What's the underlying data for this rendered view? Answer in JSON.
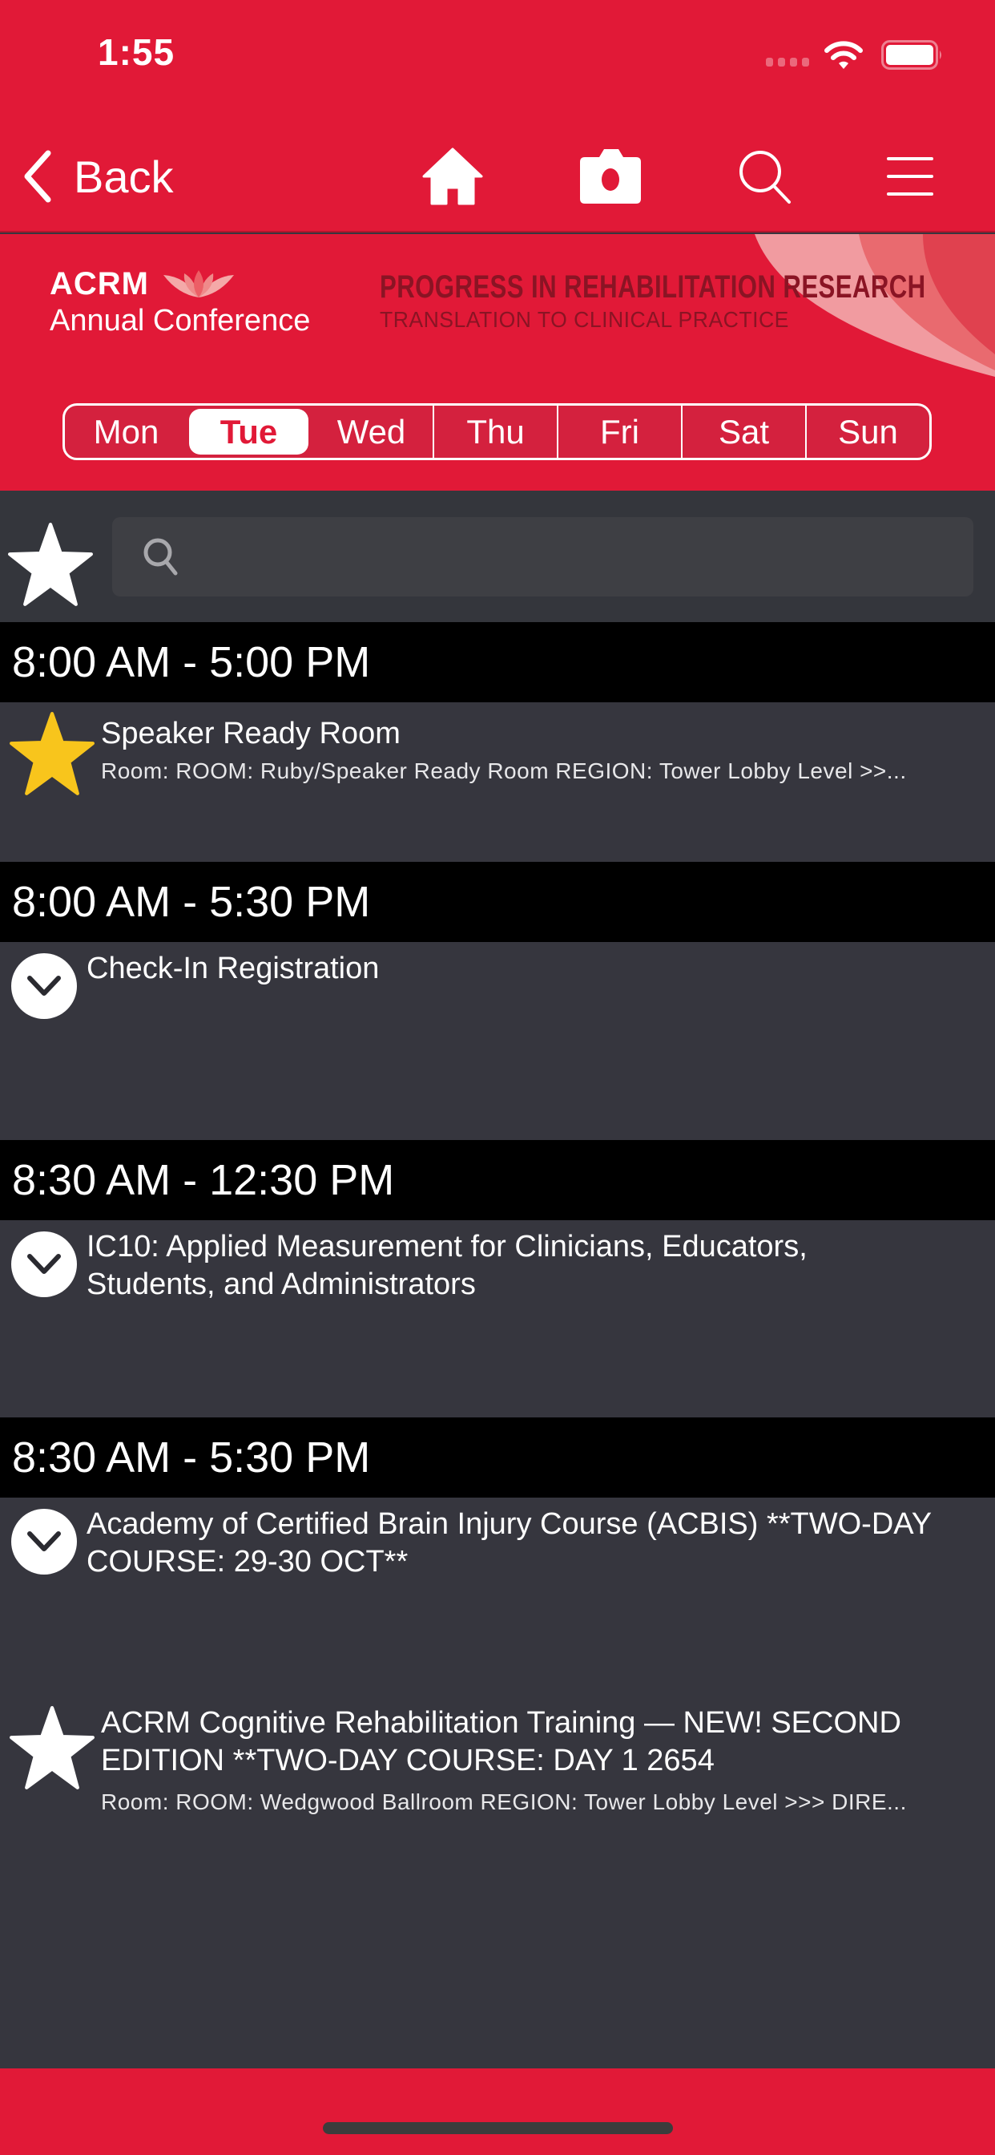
{
  "status_bar": {
    "time": "1:55",
    "wifi_icon": "wifi-icon",
    "battery_icon": "battery-full-icon",
    "signal_icon": "cellular-signal-icon"
  },
  "nav_bar": {
    "back_label": "Back",
    "icons": [
      "home-icon",
      "camera-icon",
      "search-icon",
      "menu-icon"
    ]
  },
  "banner": {
    "org": "ACRM",
    "subtitle": "Annual Conference",
    "tagline": "PROGRESS IN REHABILITATION RESEARCH",
    "tagline_sub": "TRANSLATION TO CLINICAL PRACTICE"
  },
  "days": {
    "items": [
      "Mon",
      "Tue",
      "Wed",
      "Thu",
      "Fri",
      "Sat",
      "Sun"
    ],
    "selected": "Tue"
  },
  "filter": {
    "favorites_icon": "star-icon",
    "search_placeholder": "",
    "search_value": ""
  },
  "schedule": [
    {
      "time": "8:00 AM - 5:00 PM",
      "sessions": [
        {
          "title": "Speaker Ready Room",
          "meta": "Room: ROOM: Ruby/Speaker Ready Room   REGION: Tower Lobby Level >>...",
          "icon": "star-filled-icon",
          "favorited": true
        }
      ]
    },
    {
      "time": "8:00 AM - 5:30 PM",
      "sessions": [
        {
          "title": "Check-In Registration",
          "meta": "",
          "icon": "chevron-down-icon"
        }
      ]
    },
    {
      "time": "8:30 AM - 12:30 PM",
      "sessions": [
        {
          "title": "IC10: Applied Measurement for Clinicians, Educators, Students, and Administrators",
          "meta": "",
          "icon": "chevron-down-icon"
        }
      ]
    },
    {
      "time": "8:30 AM - 5:30 PM",
      "sessions": [
        {
          "title": "Academy of Certified Brain Injury Course (ACBIS) **TWO-DAY COURSE: 29-30 OCT**",
          "meta": "",
          "icon": "chevron-down-icon"
        },
        {
          "title": "ACRM Cognitive Rehabilitation Training — NEW! SECOND EDITION **TWO-DAY COURSE: DAY 1 2654",
          "meta": "Room: ROOM: Wedgwood Ballroom  REGION: Tower Lobby Level >>> DIRE...",
          "icon": "star-outline-icon",
          "favorited": false
        }
      ]
    }
  ],
  "colors": {
    "brand_red": "#e11937",
    "list_bg": "#36363e",
    "header_bg": "#000000",
    "favorite_star": "#f8c51c"
  }
}
